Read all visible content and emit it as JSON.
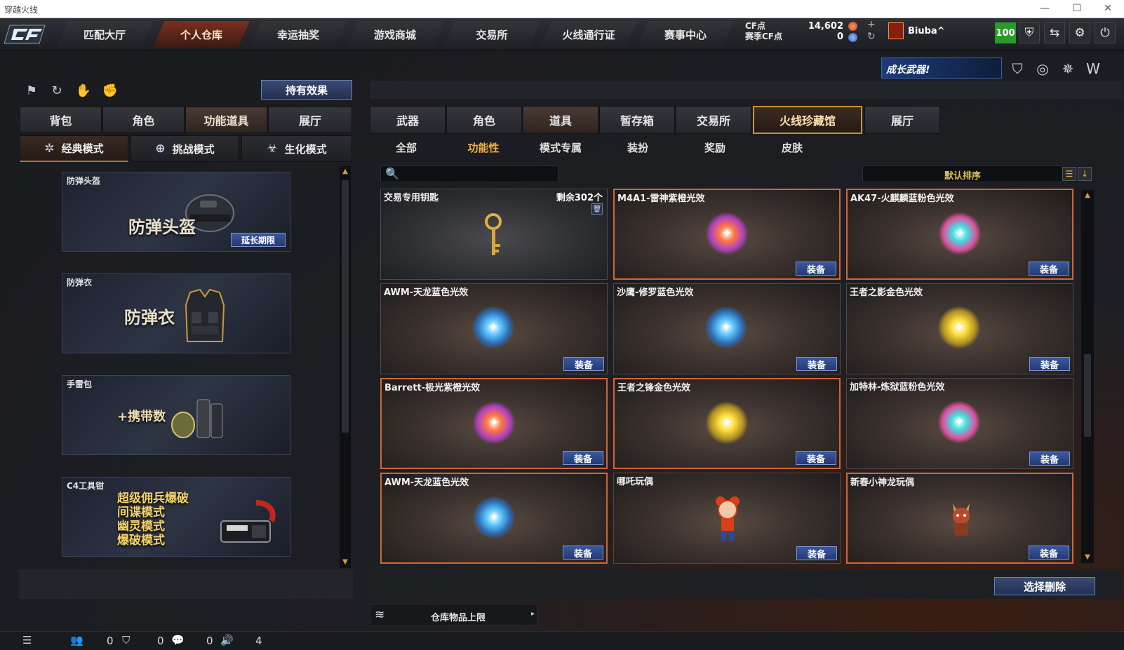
{
  "window": {
    "title": "穿越火线",
    "minimize": "—",
    "maximize": "☐",
    "close": "✕"
  },
  "topnav": {
    "logo": "CF",
    "tabs": [
      "匹配大厅",
      "个人仓库",
      "幸运抽奖",
      "游戏商城",
      "交易所",
      "火线通行证",
      "赛事中心"
    ],
    "active_tab": "个人仓库",
    "cf_label": "CF点",
    "cf_value": "14,602",
    "season_label": "赛季CF点",
    "season_value": "0",
    "plus": "+",
    "refresh": "↻",
    "username": "Biuba^",
    "level": "100",
    "icons": [
      "shield-icon",
      "exchange-icon",
      "gear-icon",
      "power-icon"
    ],
    "icon_glyphs": [
      "⛨",
      "⇆",
      "⚙",
      "⏻"
    ]
  },
  "promo": {
    "text": "成长武器!",
    "icons": [
      "⛉",
      "◎",
      "✵",
      "W"
    ]
  },
  "left": {
    "icons": [
      "⚑",
      "↻",
      "✋",
      "✊"
    ],
    "effect_button": "持有效果",
    "tabs": [
      "背包",
      "角色",
      "功能道具",
      "展厅"
    ],
    "active_tab": "功能道具",
    "modes": [
      {
        "icon": "✲",
        "label": "经典模式"
      },
      {
        "icon": "⊕",
        "label": "挑战模式"
      },
      {
        "icon": "☣",
        "label": "生化模式"
      }
    ],
    "items": [
      {
        "name": "防弹头盔",
        "big": "防弹头盔",
        "button": "延长期限"
      },
      {
        "name": "防弹衣",
        "big": "防弹衣"
      },
      {
        "name": "手雷包",
        "big": "+携带数"
      },
      {
        "name": "C4工具钳",
        "lines": [
          "超级佣兵爆破",
          "间谍模式",
          "幽灵模式",
          "爆破模式"
        ]
      }
    ],
    "scroll_up": "▲",
    "scroll_down": "▼"
  },
  "right": {
    "tabs": [
      "武器",
      "角色",
      "道具",
      "暂存箱",
      "交易所",
      "火线珍藏馆",
      "展厅"
    ],
    "active_tab": "道具",
    "subtabs": [
      "全部",
      "功能性",
      "模式专属",
      "装扮",
      "奖励",
      "皮肤"
    ],
    "active_subtab": "功能性",
    "search_icon": "🔍",
    "search_placeholder": "",
    "sort_label": "默认排序",
    "sort_icons": [
      "☰",
      "↓"
    ],
    "scroll_up": "▲",
    "scroll_down": "▼",
    "items": [
      {
        "name": "交易专用钥匙",
        "count": "剩余302个",
        "type": "key"
      },
      {
        "name": "M4A1-雷神紫橙光效",
        "button": "装备",
        "orb": "purple-orange"
      },
      {
        "name": "AK47-火麒麟蓝粉色光效",
        "button": "装备",
        "orb": "blue-pink"
      },
      {
        "name": "AWM-天龙蓝色光效",
        "button": "装备",
        "orb": "blue"
      },
      {
        "name": "沙鹰-修罗蓝色光效",
        "button": "装备",
        "orb": "blue"
      },
      {
        "name": "王者之影金色光效",
        "button": "装备",
        "orb": "gold"
      },
      {
        "name": "Barrett-极光紫橙光效",
        "button": "装备",
        "orb": "purple-orange"
      },
      {
        "name": "王者之锋金色光效",
        "button": "装备",
        "orb": "gold"
      },
      {
        "name": "加特林-炼狱蓝粉色光效",
        "button": "装备",
        "orb": "blue-pink"
      },
      {
        "name": "AWM-天龙蓝色光效",
        "button": "装备",
        "orb": "blue"
      },
      {
        "name": "哪吒玩偶",
        "button": "装备",
        "orb": "doll-red"
      },
      {
        "name": "新春小神龙玩偶",
        "button": "装备",
        "orb": "doll-dragon"
      }
    ],
    "delete_button": "选择删除",
    "capacity_label": "仓库物品上限",
    "capacity_arrow": "▸"
  },
  "statusbar": {
    "menu_icon": "☰",
    "friends_icon": "👥",
    "friends": "0",
    "clan_icon": "⛉",
    "clan": "0",
    "chat_icon": "💬",
    "chat": "0",
    "volume_icon": "🔊",
    "volume": "4"
  },
  "colors": {
    "accent_orange": "#d0663a",
    "button_blue": "#3a57a0",
    "gold_text": "#f0b040",
    "level_green": "#2a9a2a"
  }
}
